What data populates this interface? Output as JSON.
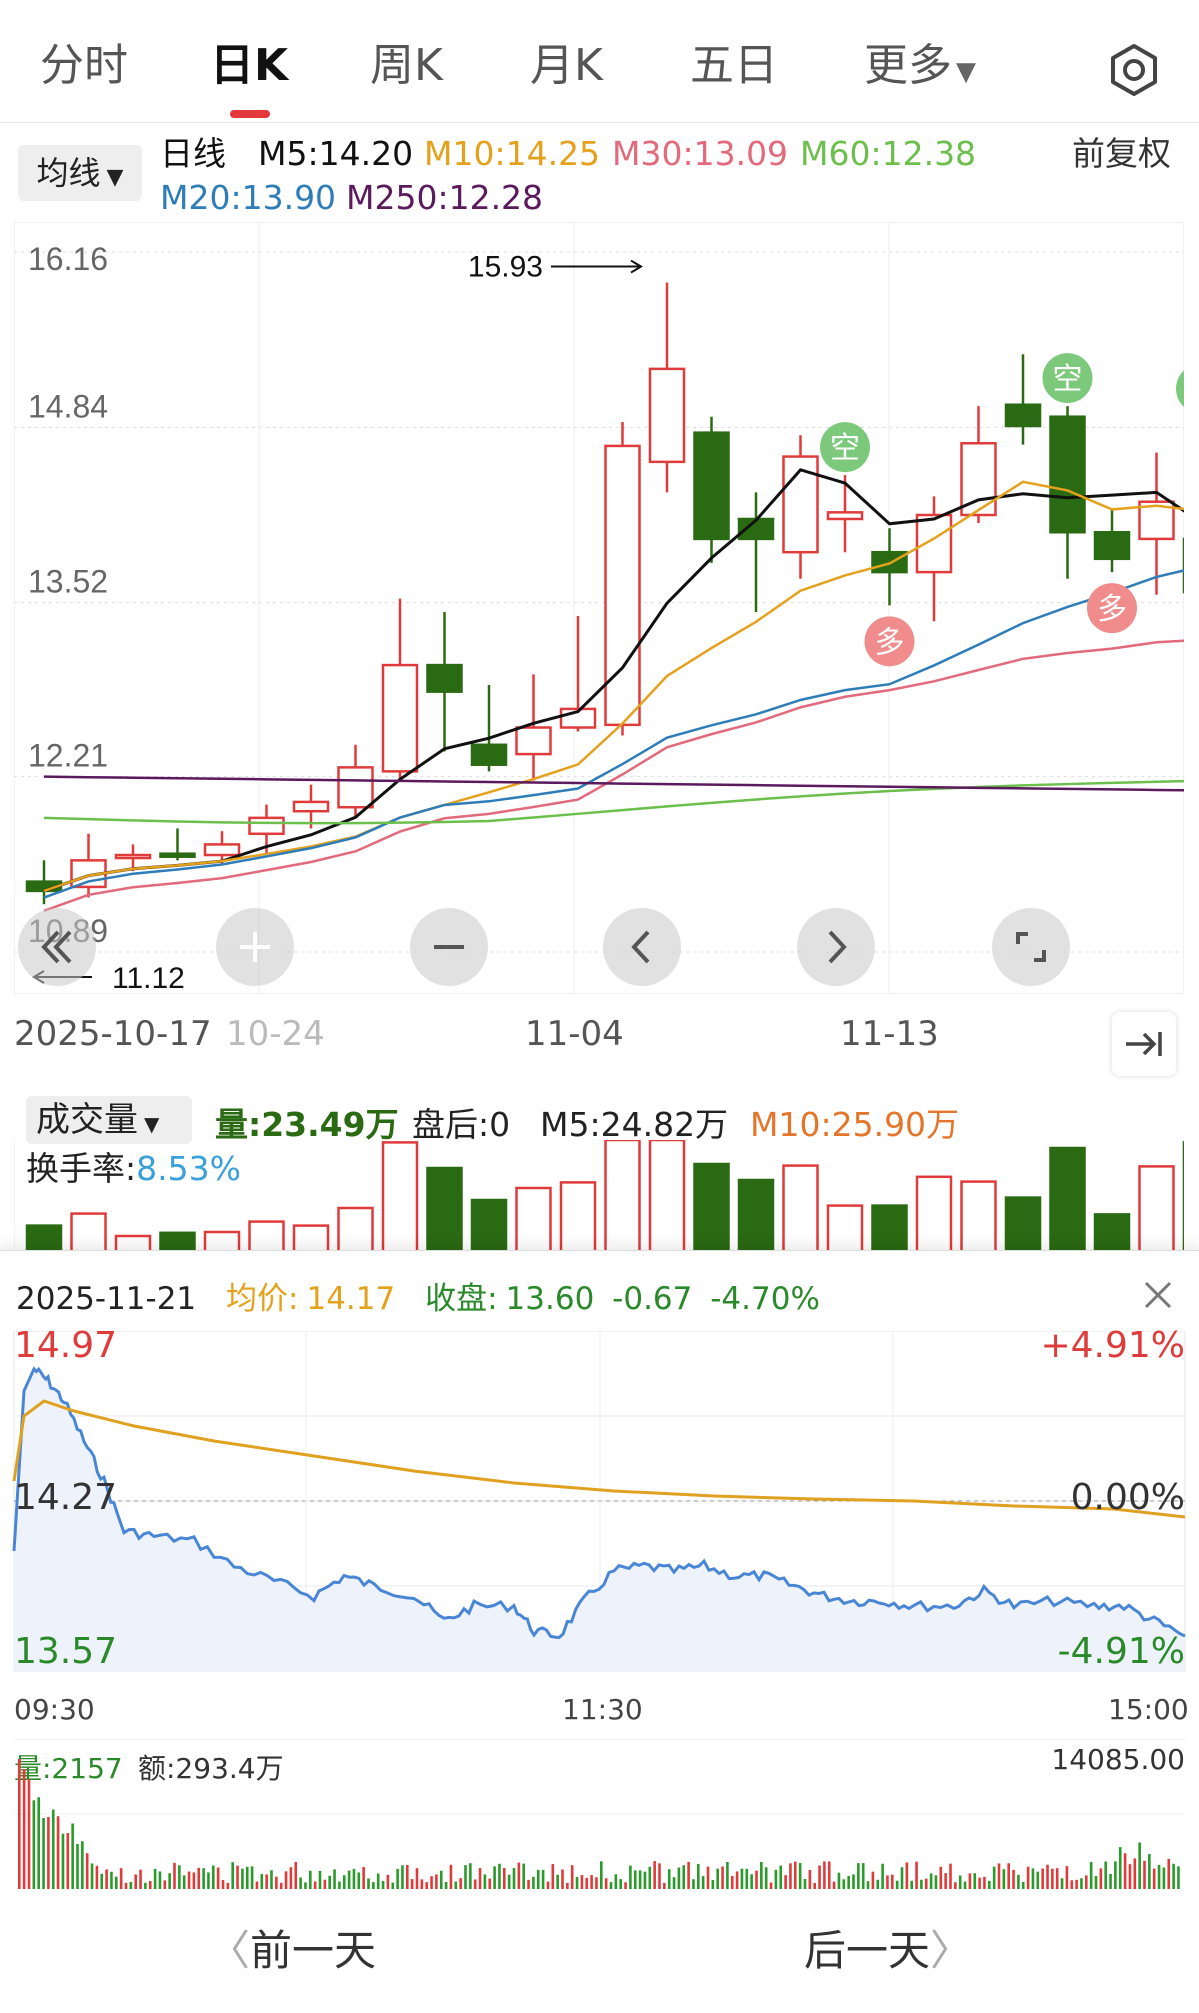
{
  "tabs": [
    {
      "label": "分时"
    },
    {
      "label": "日K"
    },
    {
      "label": "周K"
    },
    {
      "label": "月K"
    },
    {
      "label": "五日"
    },
    {
      "label": "更多"
    }
  ],
  "legend": {
    "ma_button": "均线",
    "line_type": "日线",
    "m5": "M5:14.20",
    "m10": "M10:14.25",
    "m30": "M30:13.09",
    "m60": "M60:12.38",
    "m20": "M20:13.90",
    "m250": "M250:12.28",
    "adjust": "前复权"
  },
  "colors": {
    "up": "#e03b3b",
    "down": "#2a6a12",
    "m5": "#111111",
    "m10": "#e4a11b",
    "m20": "#2e7db8",
    "m30": "#e26a7c",
    "m60": "#6dbf4d",
    "m250": "#5b1a5e",
    "signal_short": "#7cc97c",
    "signal_long": "#f08c8c"
  },
  "kline": {
    "y_ticks": [
      "16.16",
      "14.84",
      "13.52",
      "12.21",
      "10.89"
    ],
    "max_label": "15.93",
    "min_label": "11.12",
    "dates": [
      "2025-10-17",
      "10-24",
      "11-04",
      "11-13"
    ],
    "signal_short": "空",
    "signal_long": "多"
  },
  "chart_data": [
    {
      "type": "candlestick",
      "title": "",
      "ylim": [
        10.89,
        16.16
      ],
      "x_ticks": [
        "2025-10-17",
        "10-24",
        "11-04",
        "11-13"
      ],
      "candles": [
        {
          "o": 11.42,
          "h": 11.58,
          "l": 11.25,
          "c": 11.35
        },
        {
          "o": 11.38,
          "h": 11.78,
          "l": 11.3,
          "c": 11.58
        },
        {
          "o": 11.6,
          "h": 11.7,
          "l": 11.5,
          "c": 11.62
        },
        {
          "o": 11.63,
          "h": 11.82,
          "l": 11.58,
          "c": 11.62
        },
        {
          "o": 11.62,
          "h": 11.8,
          "l": 11.55,
          "c": 11.7
        },
        {
          "o": 11.78,
          "h": 12.0,
          "l": 11.62,
          "c": 11.9
        },
        {
          "o": 11.95,
          "h": 12.15,
          "l": 11.82,
          "c": 12.02
        },
        {
          "o": 11.98,
          "h": 12.45,
          "l": 11.9,
          "c": 12.28
        },
        {
          "o": 12.25,
          "h": 13.55,
          "l": 12.18,
          "c": 13.05
        },
        {
          "o": 13.05,
          "h": 13.45,
          "l": 12.4,
          "c": 12.85
        },
        {
          "o": 12.45,
          "h": 12.9,
          "l": 12.25,
          "c": 12.3
        },
        {
          "o": 12.38,
          "h": 12.98,
          "l": 12.18,
          "c": 12.58
        },
        {
          "o": 12.58,
          "h": 13.42,
          "l": 12.55,
          "c": 12.72
        },
        {
          "o": 12.6,
          "h": 14.88,
          "l": 12.52,
          "c": 14.7
        },
        {
          "o": 14.58,
          "h": 15.93,
          "l": 14.35,
          "c": 15.28
        },
        {
          "o": 14.8,
          "h": 14.92,
          "l": 13.82,
          "c": 14.0
        },
        {
          "o": 14.15,
          "h": 14.35,
          "l": 13.45,
          "c": 14.0
        },
        {
          "o": 13.9,
          "h": 14.78,
          "l": 13.7,
          "c": 14.62
        },
        {
          "o": 14.15,
          "h": 14.48,
          "l": 13.9,
          "c": 14.2
        },
        {
          "o": 13.9,
          "h": 14.08,
          "l": 13.5,
          "c": 13.75
        },
        {
          "o": 13.75,
          "h": 14.32,
          "l": 13.38,
          "c": 14.18
        },
        {
          "o": 14.18,
          "h": 15.0,
          "l": 14.12,
          "c": 14.72
        },
        {
          "o": 15.01,
          "h": 15.39,
          "l": 14.71,
          "c": 14.85
        },
        {
          "o": 14.92,
          "h": 15.0,
          "l": 13.7,
          "c": 14.05
        },
        {
          "o": 14.05,
          "h": 14.22,
          "l": 13.75,
          "c": 13.85
        },
        {
          "o": 14.0,
          "h": 14.65,
          "l": 13.58,
          "c": 14.28
        },
        {
          "o": 14.0,
          "h": 14.92,
          "l": 13.55,
          "c": 13.6
        }
      ],
      "signals": [
        {
          "label": "空",
          "index": 18
        },
        {
          "label": "空",
          "index": 23
        },
        {
          "label": "空",
          "index": 26
        },
        {
          "label": "多",
          "index": 19
        },
        {
          "label": "多",
          "index": 24
        }
      ]
    },
    {
      "type": "line",
      "title": "",
      "ylim": [
        13.57,
        14.97
      ],
      "x_ticks": [
        "09:30",
        "11:30",
        "15:00"
      ],
      "series": []
    },
    {
      "type": "bar",
      "title": "",
      "ylim": [
        0,
        14085
      ]
    }
  ],
  "volume": {
    "button": "成交量",
    "vol": "量:23.49万",
    "after": "盘后:0",
    "m5": "M5:24.82万",
    "m10": "M10:25.90万",
    "turnover_label": "换手率:",
    "turnover_value": "8.53%"
  },
  "intraday": {
    "date": "2025-11-21",
    "avg_label": "均价:",
    "avg_value": "14.17",
    "close_label": "收盘:",
    "close_value": "13.60",
    "change": "-0.67",
    "change_pct": "-4.70%",
    "price_high": "14.97",
    "price_mid": "14.27",
    "price_low": "13.57",
    "pct_high": "+4.91%",
    "pct_mid": "0.00%",
    "pct_low": "-4.91%",
    "times": [
      "09:30",
      "11:30",
      "15:00"
    ],
    "vol_label": "量:2157",
    "amount_label": "额:293.4万",
    "vol_max": "14085.00"
  },
  "nav": {
    "prev": "前一天",
    "next": "后一天"
  }
}
